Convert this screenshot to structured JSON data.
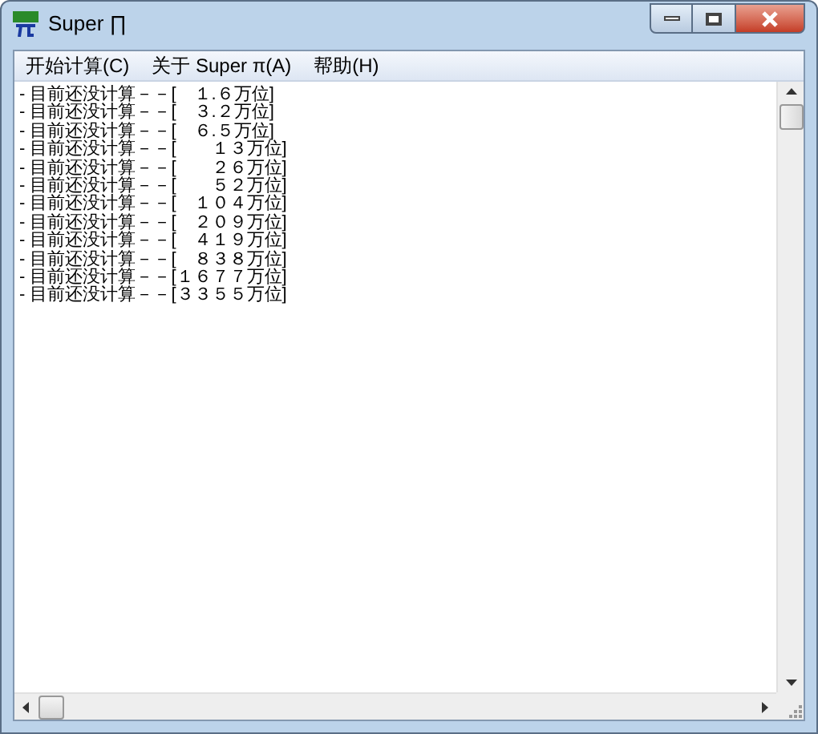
{
  "window": {
    "title": "Super ∏"
  },
  "menu": [
    {
      "label": "开始计算(C)"
    },
    {
      "label": "关于 Super π(A)"
    },
    {
      "label": "帮助(H)"
    }
  ],
  "output_lines": [
    "- 目前还没计算－－[　１.６万位]",
    "- 目前还没计算－－[　３.２万位]",
    "- 目前还没计算－－[　６.５万位]",
    "- 目前还没计算－－[　　１３万位]",
    "- 目前还没计算－－[　　２６万位]",
    "- 目前还没计算－－[　　５２万位]",
    "- 目前还没计算－－[　１０４万位]",
    "- 目前还没计算－－[　２０９万位]",
    "- 目前还没计算－－[　４１９万位]",
    "- 目前还没计算－－[　８３８万位]",
    "- 目前还没计算－－[１６７７万位]",
    "- 目前还没计算－－[３３５５万位]"
  ]
}
